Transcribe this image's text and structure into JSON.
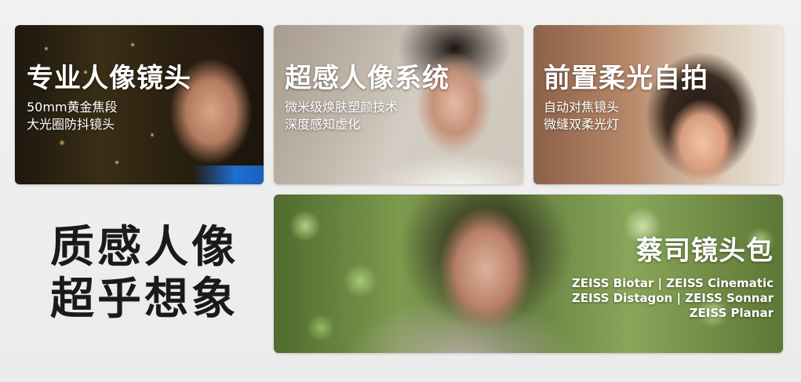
{
  "cards": [
    {
      "title": "专业人像镜头",
      "lines": [
        "50mm黄金焦段",
        "大光圈防抖镜头"
      ]
    },
    {
      "title": "超感人像系统",
      "lines": [
        "微米级焕肤塑颜技术",
        "深度感知虚化"
      ]
    },
    {
      "title": "前置柔光自拍",
      "lines": [
        "自动对焦镜头",
        "微缝双柔光灯"
      ]
    },
    {
      "title": "蔡司镜头包",
      "lines": [
        "ZEISS Biotar | ZEISS Cinematic",
        "ZEISS Distagon | ZEISS Sonnar",
        "ZEISS Planar"
      ]
    }
  ],
  "headline": {
    "line1": "质感人像",
    "line2": "超乎想象"
  }
}
